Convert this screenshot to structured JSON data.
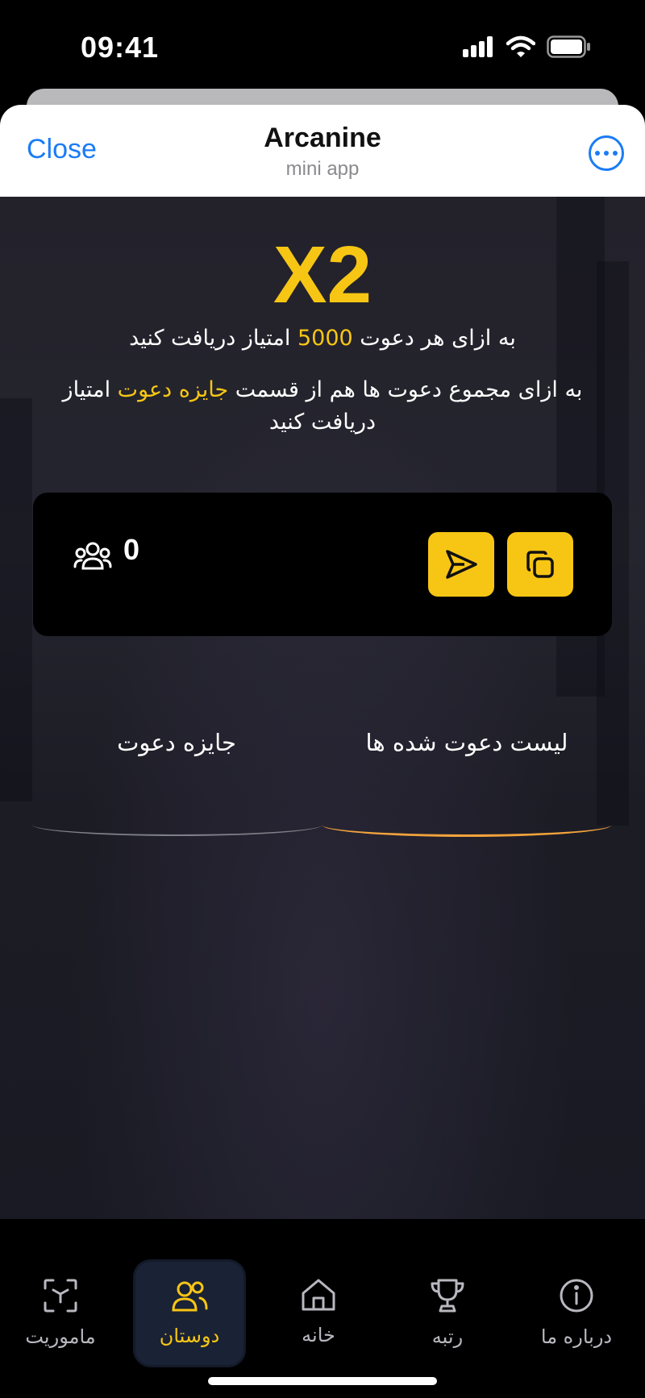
{
  "status_bar": {
    "time": "09:41"
  },
  "header": {
    "close_label": "Close",
    "title": "Arcanine",
    "subtitle": "mini app"
  },
  "hero": {
    "multiplier": "X2",
    "line1_prefix": "به ازای هر دعوت ",
    "line1_points": "5000",
    "line1_suffix": " امتیاز دریافت کنید",
    "line2_prefix": "به ازای مجموع دعوت ها هم از قسمت ",
    "line2_highlight": "جایزه دعوت",
    "line2_suffix": " امتیاز دریافت کنید"
  },
  "invite_card": {
    "friends_count": "0"
  },
  "tabs": [
    {
      "label": "لیست دعوت شده ها",
      "active": true
    },
    {
      "label": "جایزه دعوت",
      "active": false
    }
  ],
  "bottom_nav": [
    {
      "label": "ماموریت",
      "icon": "scan-icon",
      "active": false
    },
    {
      "label": "دوستان",
      "icon": "users-icon",
      "active": true
    },
    {
      "label": "خانه",
      "icon": "home-icon",
      "active": false
    },
    {
      "label": "رتبه",
      "icon": "trophy-icon",
      "active": false
    },
    {
      "label": "درباره ما",
      "icon": "info-icon",
      "active": false
    }
  ],
  "colors": {
    "accent": "#f7c614",
    "link": "#1a7cf5",
    "active_underline": "#f2a33c"
  }
}
